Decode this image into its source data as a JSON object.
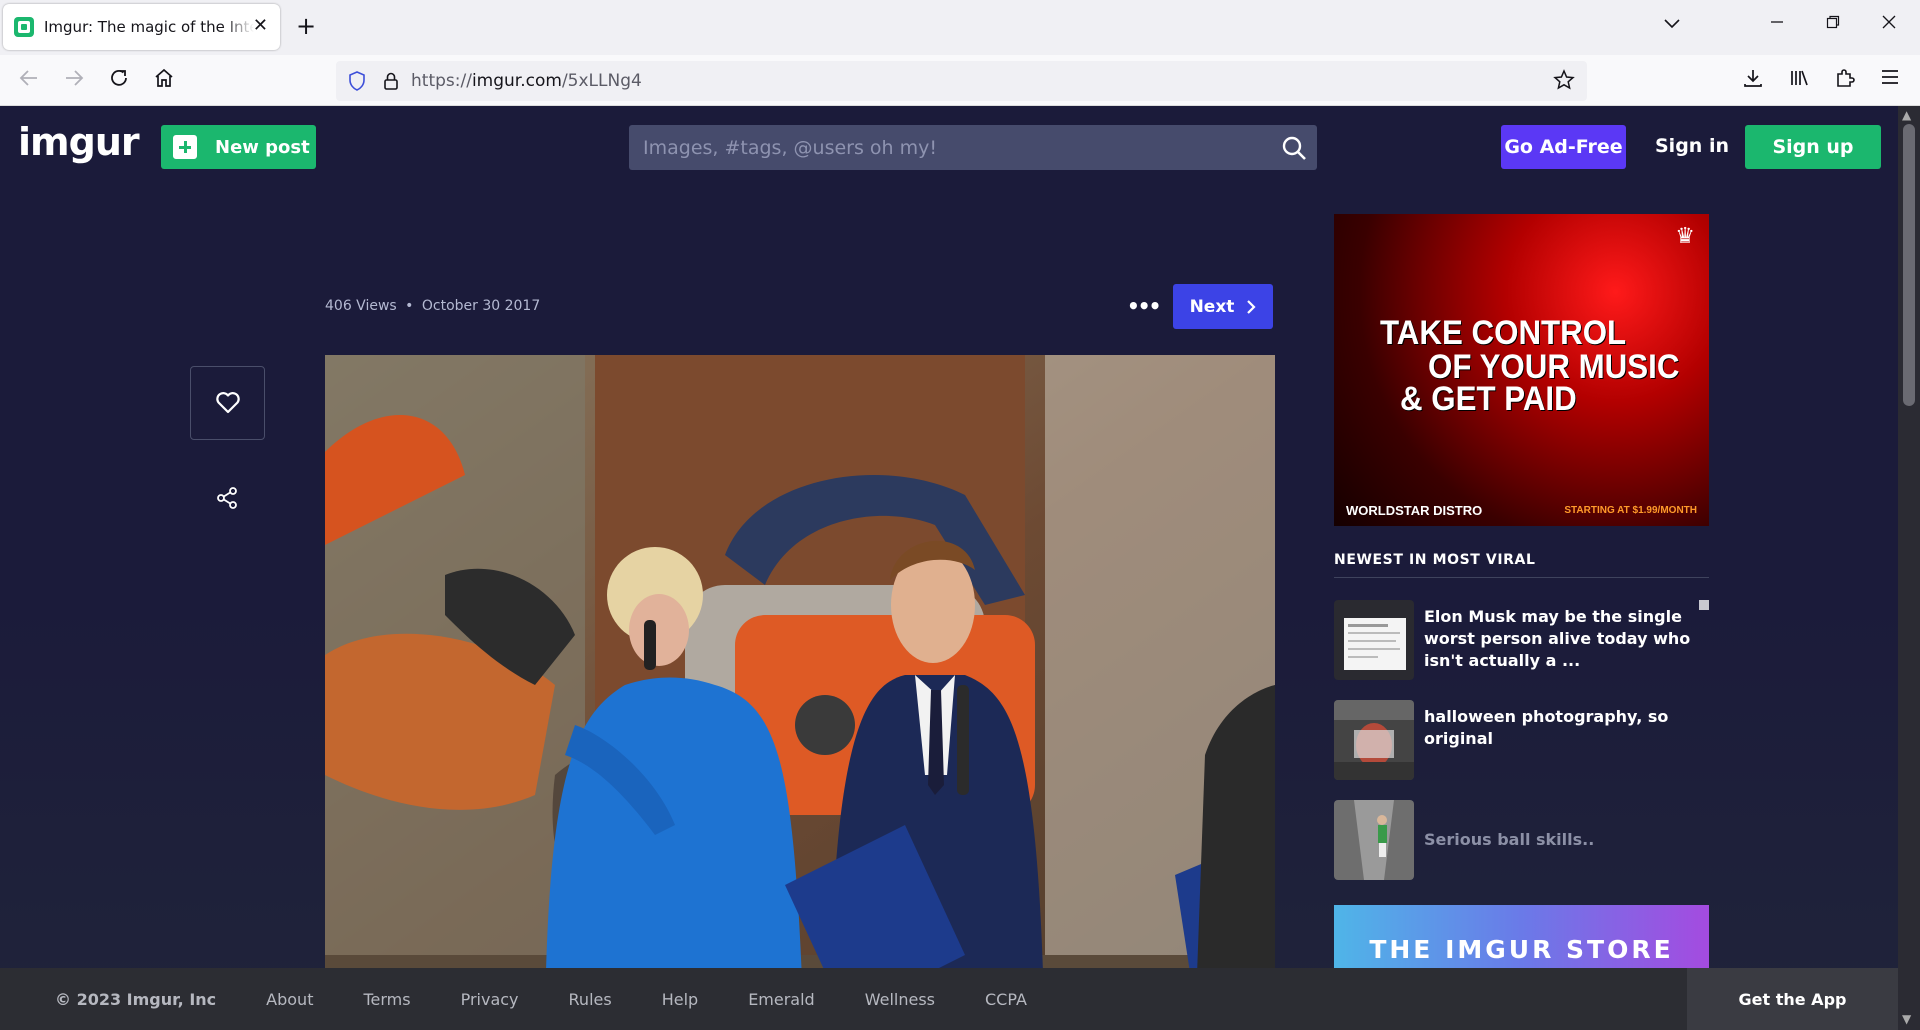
{
  "browser": {
    "tab_title": "Imgur: The magic of the Internet",
    "url_prefix": "https://",
    "url_host": "imgur.com",
    "url_path": "/5xLLNg4",
    "new_tab": "+",
    "close": "✕",
    "tabs_dropdown": "⌄",
    "minimize": "—",
    "restore": "❐",
    "window_close": "✕"
  },
  "header": {
    "logo": "imgur",
    "new_post": "New post",
    "search_placeholder": "Images, #tags, @users oh my!",
    "go_ad_free": "Go Ad-Free",
    "sign_in": "Sign in",
    "sign_up": "Sign up"
  },
  "post": {
    "views": "406 Views",
    "separator": "•",
    "date": "October 30 2017",
    "more": "•••",
    "next": "Next",
    "next_chevron": "›"
  },
  "ad": {
    "line1": "TAKE CONTROL",
    "line2": "OF YOUR MUSIC",
    "line3": "& GET PAID",
    "brand": "WORLDSTAR  DISTRO",
    "price": "STARTING AT $1.99/MONTH"
  },
  "newest_viral": {
    "title": "NEWEST IN MOST VIRAL",
    "items": [
      {
        "text": "Elon Musk may be the single worst person alive today who isn't actually a ..."
      },
      {
        "text": "halloween photography, so original"
      },
      {
        "text": "Serious ball skills.."
      }
    ]
  },
  "store": {
    "label": "THE IMGUR STORE"
  },
  "footer": {
    "copyright": "© 2023 Imgur, Inc",
    "links": [
      "About",
      "Terms",
      "Privacy",
      "Rules",
      "Help",
      "Emerald",
      "Wellness",
      "CCPA"
    ],
    "get_app": "Get the App"
  },
  "colors": {
    "page_bg": "#1b1b3a",
    "green": "#1bb76e",
    "purple": "#5b38f5",
    "blue": "#3c43e6"
  }
}
